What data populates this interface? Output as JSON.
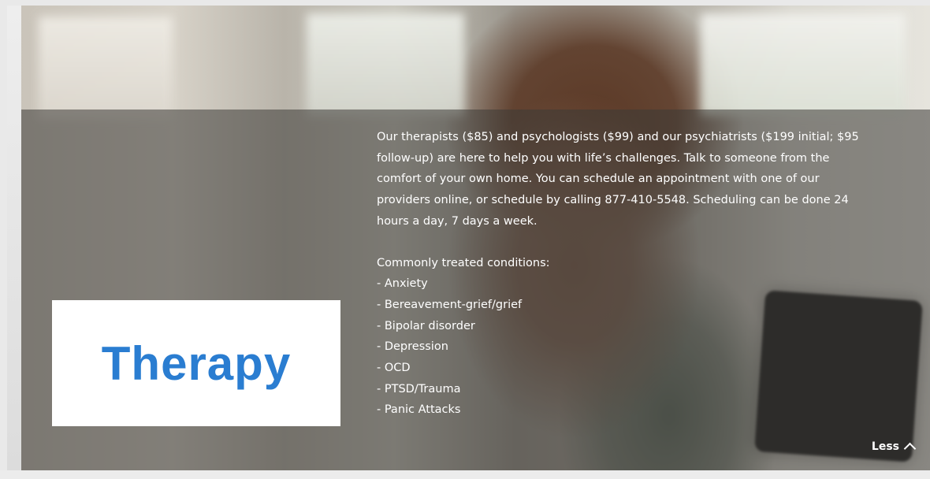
{
  "logo": {
    "text": "Therapy"
  },
  "description": {
    "paragraph": "Our therapists ($85) and psychologists ($99) and our psychiatrists ($199 initial; $95 follow-up) are here to help you with life’s challenges. Talk to someone from the comfort of your own home. You can schedule an appointment with one of our providers online, or schedule by calling 877-410-5548. Scheduling can be done 24 hours a day, 7 days a week.",
    "conditions_heading": "Commonly treated conditions:",
    "conditions": [
      "- Anxiety",
      "- Bereavement-grief/grief",
      "- Bipolar disorder",
      "- Depression",
      "- OCD",
      "- PTSD/Trauma",
      "- Panic Attacks"
    ]
  },
  "toggle": {
    "label": "Less",
    "icon": "chevron-up-icon"
  },
  "colors": {
    "logo_text": "#2a7dd1",
    "overlay": "rgba(60,58,55,0.55)",
    "text": "#ffffff"
  }
}
